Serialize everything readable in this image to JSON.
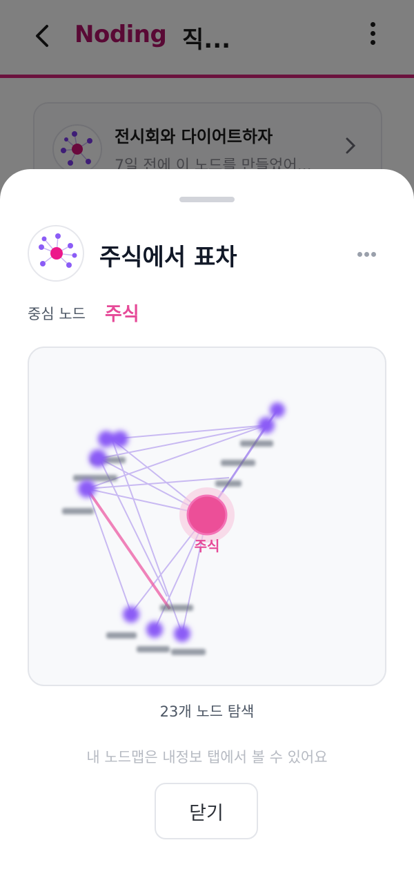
{
  "header": {
    "brand": "Noding",
    "title": "직..."
  },
  "background_card": {
    "title": "전시회와 다이어트하자",
    "subtitle": "7일 전에 이 노드를 만들었어..."
  },
  "sheet": {
    "title": "주식에서 표차",
    "center_label": "중심 노드",
    "center_value": "주식",
    "graph": {
      "center_node_label": "주식",
      "accent_color": "#e6489a",
      "node_color": "#8b5cf6"
    },
    "count_text": "23개 노드 탐색",
    "hint_text": "내 노드맵은 내정보 탭에서 볼 수 있어요",
    "close_label": "닫기"
  },
  "icons": [
    "back-arrow-icon",
    "more-vertical-icon",
    "node-network-icon",
    "chevron-right-icon",
    "more-horizontal-icon"
  ]
}
